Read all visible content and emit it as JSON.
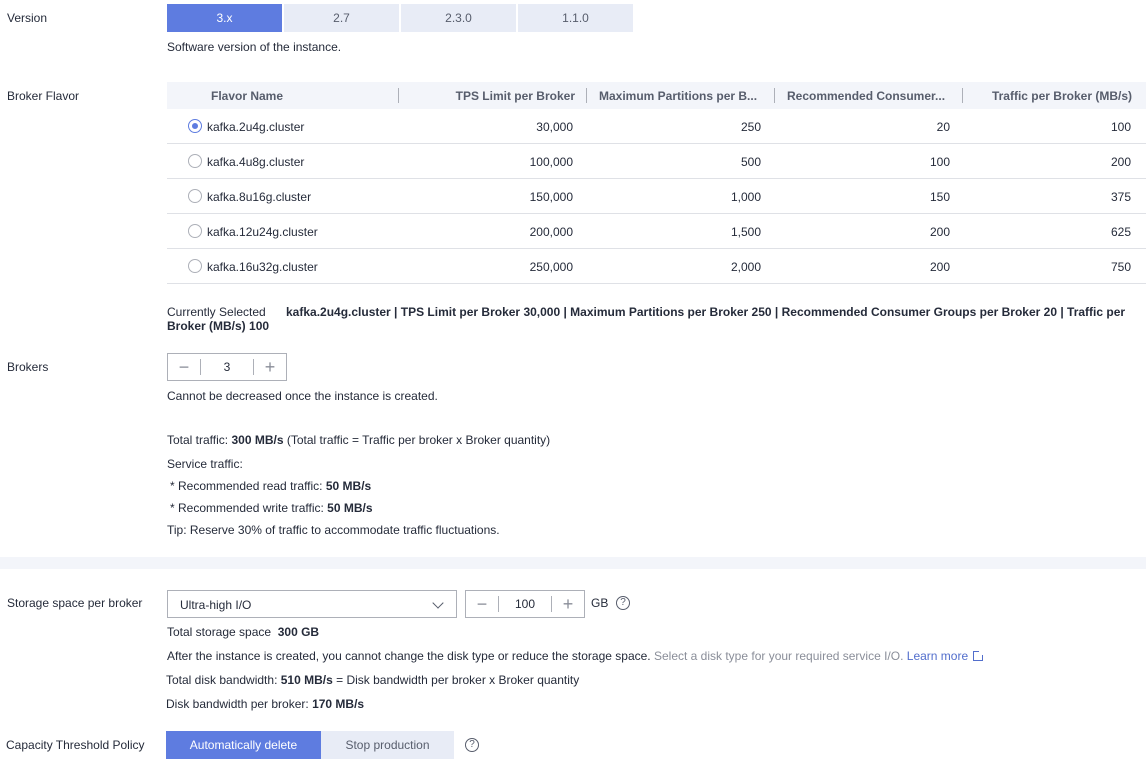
{
  "version": {
    "label": "Version",
    "options": [
      "3.x",
      "2.7",
      "2.3.0",
      "1.1.0"
    ],
    "selected": "3.x",
    "hint": "Software version of the instance."
  },
  "broker_flavor": {
    "label": "Broker Flavor",
    "columns": [
      "Flavor Name",
      "TPS Limit per Broker",
      "Maximum Partitions per B...",
      "Recommended Consumer...",
      "Traffic per Broker (MB/s)"
    ],
    "rows": [
      {
        "name": "kafka.2u4g.cluster",
        "tps": "30,000",
        "partitions": "250",
        "consumers": "20",
        "traffic": "100",
        "selected": true
      },
      {
        "name": "kafka.4u8g.cluster",
        "tps": "100,000",
        "partitions": "500",
        "consumers": "100",
        "traffic": "200",
        "selected": false
      },
      {
        "name": "kafka.8u16g.cluster",
        "tps": "150,000",
        "partitions": "1,000",
        "consumers": "150",
        "traffic": "375",
        "selected": false
      },
      {
        "name": "kafka.12u24g.cluster",
        "tps": "200,000",
        "partitions": "1,500",
        "consumers": "200",
        "traffic": "625",
        "selected": false
      },
      {
        "name": "kafka.16u32g.cluster",
        "tps": "250,000",
        "partitions": "2,000",
        "consumers": "200",
        "traffic": "750",
        "selected": false
      }
    ],
    "currently_selected_label": "Currently Selected",
    "currently_selected_value": "kafka.2u4g.cluster | TPS Limit per Broker 30,000 | Maximum Partitions per Broker 250 | Recommended Consumer Groups per Broker 20 | Traffic per Broker (MB/s) 100"
  },
  "brokers": {
    "label": "Brokers",
    "value": "3",
    "minus": "−",
    "plus": "+",
    "hint": "Cannot be decreased once the instance is created.",
    "total_traffic_prefix": "Total traffic: ",
    "total_traffic_value": "300 MB/s",
    "total_traffic_suffix": " (Total traffic = Traffic per broker x Broker quantity)",
    "service_traffic": "Service traffic:",
    "read_prefix": "* Recommended read traffic: ",
    "read_value": "50 MB/s",
    "write_prefix": "* Recommended write traffic: ",
    "write_value": "50 MB/s",
    "tip": "Tip: Reserve 30% of traffic to accommodate traffic fluctuations."
  },
  "storage": {
    "label": "Storage space per broker",
    "disk_type": "Ultra-high I/O",
    "size": "100",
    "unit": "GB",
    "minus": "−",
    "plus": "+",
    "total_label": "Total storage space",
    "total_value": "300 GB",
    "notice": "After the instance is created, you cannot change the disk type or reduce the storage space.",
    "notice_gray": "Select a disk type for your required service I/O.",
    "learn_more": "Learn more",
    "bandwidth_prefix": "Total disk bandwidth: ",
    "bandwidth_value": "510 MB/s",
    "bandwidth_suffix": " = Disk bandwidth per broker x Broker quantity",
    "per_broker_prefix": "Disk bandwidth per broker: ",
    "per_broker_value": "170 MB/s"
  },
  "capacity": {
    "label": "Capacity Threshold Policy",
    "options": [
      "Automatically delete",
      "Stop production"
    ],
    "selected": "Automatically delete"
  },
  "icons": {
    "help": "?",
    "accent": "#5e7ce0"
  }
}
